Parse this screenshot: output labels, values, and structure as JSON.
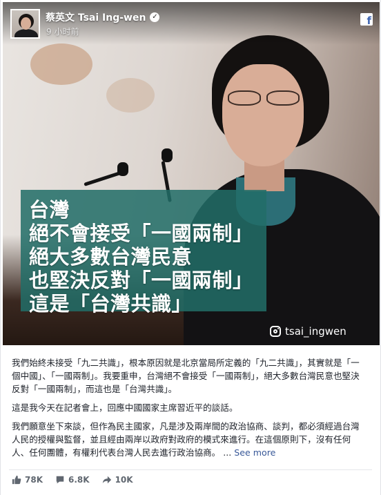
{
  "post": {
    "author_name": "蔡英文 Tsai Ing-wen",
    "timestamp": "9 小时前",
    "image_text_lines": [
      "台灣",
      "絕不會接受「一國兩制」",
      "絕大多數台灣民意",
      "也堅決反對「一國兩制」",
      "這是「台灣共識」"
    ],
    "instagram_handle": "tsai_ingwen",
    "paragraphs": [
      "我們始終未接受「九二共識」，根本原因就是北京當局所定義的「九二共識」，其實就是「一個中國」、「一國兩制」。我要重申，台灣絕不會接受「一國兩制」，絕大多數台灣民意也堅決反對「一國兩制」，而這也是「台灣共識」。",
      "這是我今天在記者會上，回應中國國家主席習近平的談話。",
      "我們願意坐下來談，但作為民主國家，凡是涉及兩岸間的政治協商、談判，都必須經過台灣人民的授權與監督，並且經由兩岸以政府對政府的模式來進行。在這個原則下，沒有任何人、任何團體，有權利代表台灣人民去進行政治協商。 ..."
    ],
    "see_more_label": "See more"
  },
  "stats": {
    "likes": "78K",
    "comments": "6.8K",
    "shares": "10K"
  },
  "icons": {
    "verified": "verified-check-icon",
    "platform": "facebook-logo-icon",
    "instagram": "instagram-icon",
    "like": "thumbs-up-icon",
    "comment": "comment-icon",
    "share": "share-arrow-icon"
  },
  "colors": {
    "overlay": "#226e68",
    "link": "#385898",
    "facebook_blue": "#4267b2",
    "meta_text": "#606770"
  }
}
